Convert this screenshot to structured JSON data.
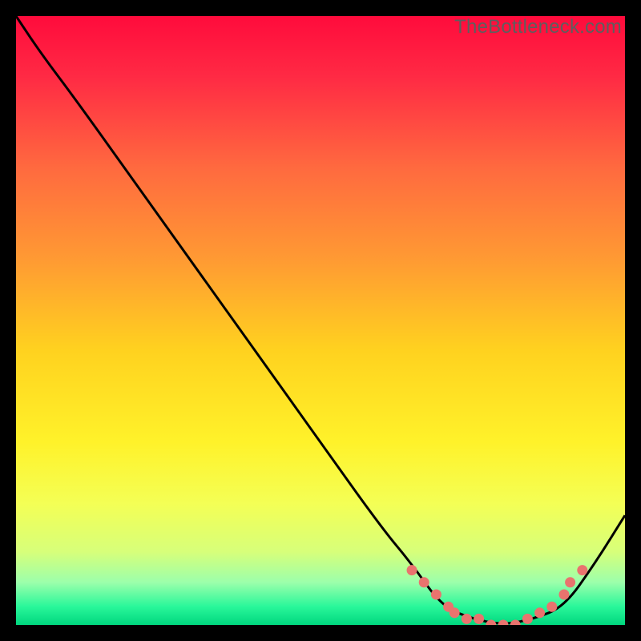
{
  "watermark": "TheBottleneck.com",
  "chart_data": {
    "type": "line",
    "title": "",
    "xlabel": "",
    "ylabel": "",
    "xlim": [
      0,
      100
    ],
    "ylim": [
      0,
      100
    ],
    "curve": {
      "name": "bottleneck-curve",
      "x": [
        0,
        4,
        10,
        20,
        30,
        40,
        50,
        60,
        65,
        70,
        75,
        80,
        85,
        90,
        95,
        100
      ],
      "y": [
        100,
        94,
        86,
        72,
        58,
        44,
        30,
        16,
        10,
        3,
        1,
        0,
        1,
        3,
        10,
        18
      ]
    },
    "dot_basin": {
      "name": "basin-dots",
      "color": "#e9736e",
      "x": [
        65,
        67,
        69,
        71,
        72,
        74,
        76,
        78,
        80,
        82,
        84,
        86,
        88,
        90,
        91,
        93
      ],
      "y": [
        9,
        7,
        5,
        3,
        2,
        1,
        1,
        0,
        0,
        0,
        1,
        2,
        3,
        5,
        7,
        9
      ]
    },
    "gradient_stops": [
      {
        "offset": 0.0,
        "color": "#ff0b3c"
      },
      {
        "offset": 0.1,
        "color": "#ff2a44"
      },
      {
        "offset": 0.25,
        "color": "#ff6a3f"
      },
      {
        "offset": 0.4,
        "color": "#ff9a33"
      },
      {
        "offset": 0.55,
        "color": "#ffd21f"
      },
      {
        "offset": 0.7,
        "color": "#fff22a"
      },
      {
        "offset": 0.8,
        "color": "#f4ff55"
      },
      {
        "offset": 0.88,
        "color": "#d7ff7a"
      },
      {
        "offset": 0.93,
        "color": "#9cffab"
      },
      {
        "offset": 0.97,
        "color": "#29f79a"
      },
      {
        "offset": 1.0,
        "color": "#00d67e"
      }
    ]
  }
}
